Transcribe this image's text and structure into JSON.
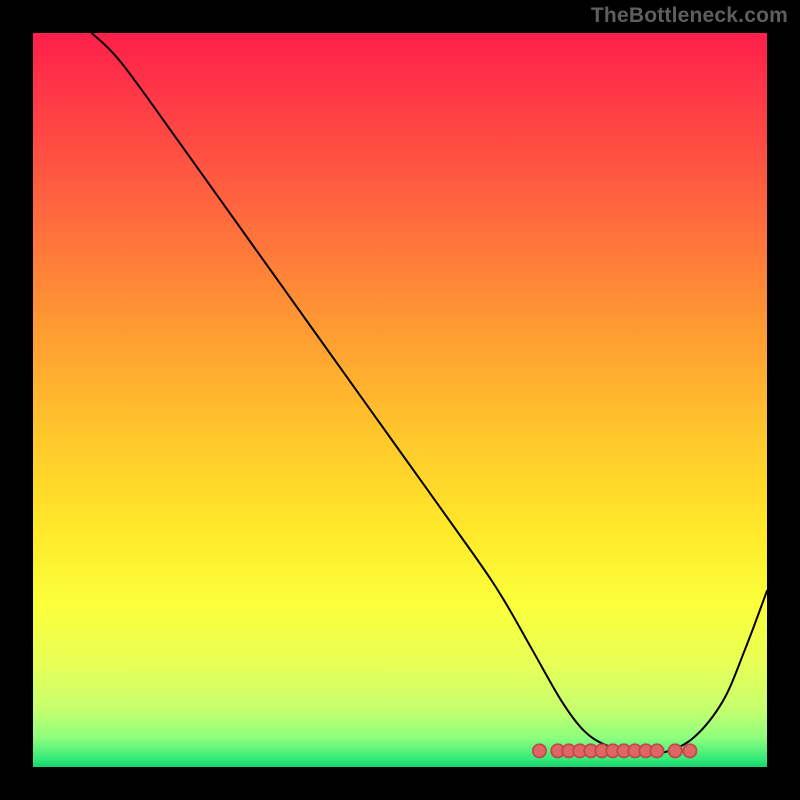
{
  "watermark": "TheBottleneck.com",
  "colors": {
    "frame_bg": "#000000",
    "curve": "#000000",
    "marker_fill": "#e06666",
    "marker_stroke": "#c04a4a",
    "watermark": "#5e5e5e"
  },
  "chart_data": {
    "type": "line",
    "title": "",
    "xlabel": "",
    "ylabel": "",
    "xlim": [
      0,
      100
    ],
    "ylim": [
      0,
      100
    ],
    "grid": false,
    "legend": false,
    "background": "rainbow-gradient (red top → green bottom)",
    "series": [
      {
        "name": "curve",
        "x": [
          8,
          12,
          20,
          30,
          40,
          50,
          60,
          64,
          68,
          72,
          75,
          78,
          82,
          86,
          90,
          94,
          97,
          100
        ],
        "y": [
          100,
          96,
          85,
          71,
          57,
          43,
          29,
          23,
          16,
          9,
          5,
          3,
          2,
          2,
          4,
          9,
          16,
          24
        ]
      }
    ],
    "markers": {
      "name": "floor-dots",
      "y": 2.2,
      "x_sequence": [
        69,
        71.5,
        73,
        74.5,
        76,
        77.5,
        79,
        80.5,
        82,
        83.5,
        85,
        87.5,
        89.5
      ]
    }
  }
}
